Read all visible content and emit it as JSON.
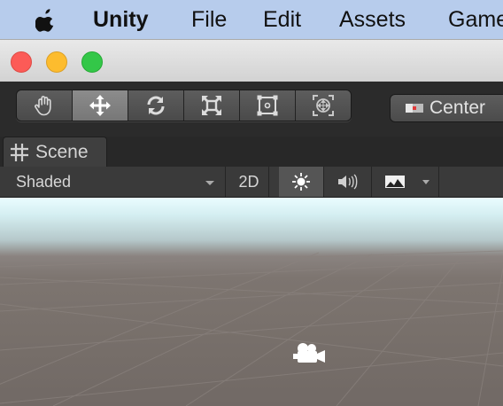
{
  "menubar": {
    "app_name": "Unity",
    "items": [
      "File",
      "Edit",
      "Assets",
      "Game"
    ],
    "bg_color": "#b7ccec"
  },
  "window": {
    "traffic_lights": [
      "close",
      "minimize",
      "zoom"
    ]
  },
  "toolbar": {
    "tools": [
      {
        "name": "hand-tool",
        "icon": "hand-icon",
        "active": false
      },
      {
        "name": "move-tool",
        "icon": "move-arrows-icon",
        "active": true
      },
      {
        "name": "rotate-tool",
        "icon": "rotate-icon",
        "active": false
      },
      {
        "name": "scale-tool",
        "icon": "scale-icon",
        "active": false
      },
      {
        "name": "rect-tool",
        "icon": "rect-transform-icon",
        "active": false
      },
      {
        "name": "transform-tool",
        "icon": "transform-icon",
        "active": false
      }
    ],
    "pivot_label": "Center"
  },
  "scene_tab": {
    "label": "Scene"
  },
  "scene_toolbar": {
    "draw_mode": "Shaded",
    "mode_2d": "2D",
    "lighting_on": true
  }
}
